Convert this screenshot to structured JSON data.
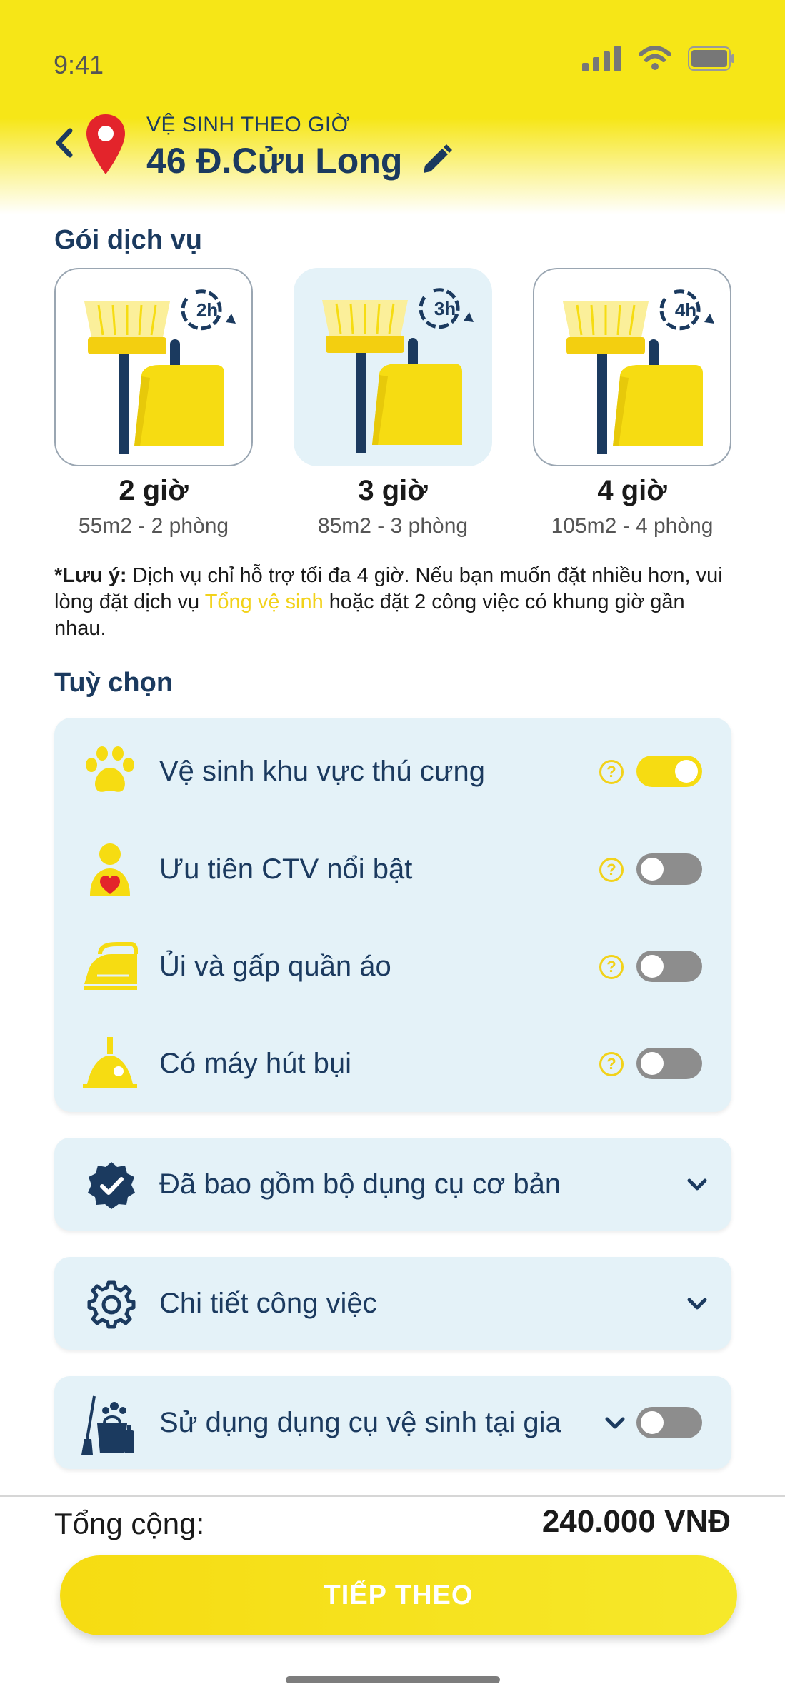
{
  "status_bar": {
    "time": "9:41"
  },
  "header": {
    "subtitle": "VỆ SINH THEO GIỜ",
    "address": "46 Đ.Cửu Long"
  },
  "packages": {
    "title": "Gói dịch vụ",
    "items": [
      {
        "badge": "2h",
        "name": "2 giờ",
        "desc": "55m2 - 2 phòng",
        "selected": false
      },
      {
        "badge": "3h",
        "name": "3 giờ",
        "desc": "85m2 - 3 phòng",
        "selected": true
      },
      {
        "badge": "4h",
        "name": "4 giờ",
        "desc": "105m2 - 4 phòng",
        "selected": false
      }
    ]
  },
  "note": {
    "prefix": "*Lưu ý:",
    "text1": " Dịch vụ chỉ hỗ trợ tối đa 4 giờ. Nếu bạn muốn đặt nhiều hơn, vui lòng đặt dịch vụ ",
    "link": "Tổng vệ sinh",
    "text2": " hoặc đặt 2 công việc có khung giờ gần nhau."
  },
  "options": {
    "title": "Tuỳ chọn",
    "items": [
      {
        "label": "Vệ sinh khu vực thú cưng",
        "icon": "paw-icon",
        "on": true
      },
      {
        "label": "Ưu tiên CTV nổi bật",
        "icon": "person-heart-icon",
        "on": false
      },
      {
        "label": "Ủi và gấp quần áo",
        "icon": "iron-icon",
        "on": false
      },
      {
        "label": "Có máy hút bụi",
        "icon": "vacuum-icon",
        "on": false
      }
    ],
    "help_glyph": "?"
  },
  "accordions": {
    "tools": "Đã bao gồm bộ dụng cụ cơ bản",
    "details": "Chi tiết công việc",
    "home_tools": "Sử dụng dụng cụ vệ sinh tại gia"
  },
  "footer": {
    "total_label": "Tổng cộng:",
    "total_value": "240.000 VNĐ",
    "next_label": "TIẾP THEO"
  },
  "colors": {
    "brand_yellow": "#f6dc12",
    "navy": "#1b3a5f",
    "card_bg": "#e4f2f8",
    "pin_red": "#e3242b"
  }
}
